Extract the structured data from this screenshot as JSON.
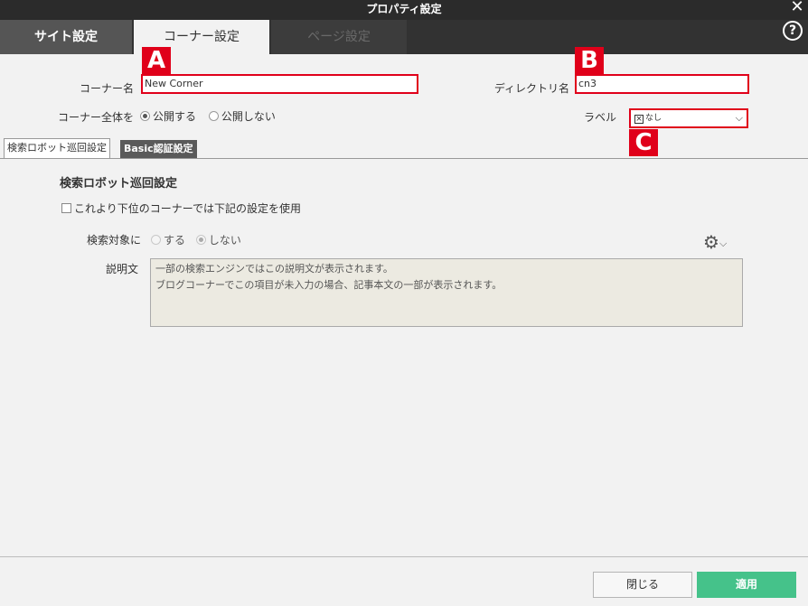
{
  "window": {
    "title": "プロパティ設定",
    "close_icon": "close-icon",
    "help_icon": "help-icon",
    "help_glyph": "?"
  },
  "tabs": [
    {
      "label": "サイト設定"
    },
    {
      "label": "コーナー設定",
      "active": true
    },
    {
      "label": "ページ設定",
      "disabled": true
    }
  ],
  "form": {
    "corner_name": {
      "label": "コーナー名",
      "value": "New Corner"
    },
    "directory_name": {
      "label": "ディレクトリ名",
      "value": "cn3"
    },
    "visibility": {
      "label": "コーナー全体を",
      "options": [
        "公開する",
        "公開しない"
      ],
      "selected": "公開する"
    },
    "label_field": {
      "label": "ラベル",
      "selected_value": "なし"
    }
  },
  "callouts": {
    "a": "A",
    "b": "B",
    "c": "C"
  },
  "subtabs": [
    {
      "label": "検索ロボット巡回設定",
      "active": true
    },
    {
      "label": "Basic認証設定"
    }
  ],
  "robot_section": {
    "title": "検索ロボット巡回設定",
    "inherit_checkbox_label": "これより下位のコーナーでは下記の設定を使用",
    "search_target": {
      "label": "検索対象に",
      "options": [
        "する",
        "しない"
      ],
      "selected": "しない"
    },
    "description": {
      "label": "説明文",
      "placeholder_lines": [
        "一部の検索エンジンではこの説明文が表示されます。",
        "ブログコーナーでこの項目が未入力の場合、記事本文の一部が表示されます。"
      ]
    }
  },
  "footer": {
    "close_label": "閉じる",
    "apply_label": "適用"
  },
  "colors": {
    "accent_red": "#e0001a",
    "apply_green": "#45c28a",
    "titlebar": "#2b2b2b"
  }
}
